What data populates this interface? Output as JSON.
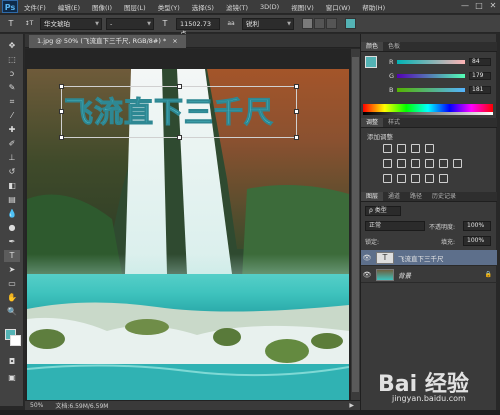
{
  "app": {
    "logo": "Ps"
  },
  "menu": [
    "文件(F)",
    "编辑(E)",
    "图像(I)",
    "图层(L)",
    "类型(Y)",
    "选择(S)",
    "滤镜(T)",
    "3D(D)",
    "视图(V)",
    "窗口(W)",
    "帮助(H)"
  ],
  "window_buttons": [
    "—",
    "□",
    "✕"
  ],
  "options": {
    "tool_icon": "T",
    "orient_icon": "↕T",
    "font_family": "华文琥珀",
    "font_style": "-",
    "font_size_icon": "T",
    "font_size": "11502.73 点",
    "aa_icon": "aa",
    "antialias": "锐利"
  },
  "document": {
    "tab_label": "1.jpg @ 50% (飞流直下三千尺, RGB/8#) *",
    "tab_close": "×",
    "text_content": "飞流直下三千尺"
  },
  "status": {
    "zoom": "50%",
    "doc_info": "文档:6.59M/6.59M"
  },
  "color_panel": {
    "tabs": [
      "颜色",
      "色板"
    ],
    "r_label": "R",
    "g_label": "G",
    "b_label": "B",
    "r": "84",
    "g": "179",
    "b": "181",
    "fg_color": "#54b3b5"
  },
  "adjust_panel": {
    "tabs": [
      "调整",
      "样式"
    ],
    "title": "添加调整"
  },
  "layers_panel": {
    "tabs": [
      "图层",
      "通道",
      "路径",
      "历史记录"
    ],
    "filter_label": "ρ 类型",
    "blend_mode": "正常",
    "opacity_label": "不透明度:",
    "opacity": "100%",
    "lock_label": "锁定:",
    "fill_label": "填充:",
    "fill": "100%",
    "layers": [
      {
        "name": "飞流直下三千尺",
        "kind": "text",
        "thumb": "T"
      },
      {
        "name": "背景",
        "kind": "image",
        "thumb": ""
      }
    ]
  },
  "watermark": {
    "main": "Bai 经验",
    "sub": "jingyan.baidu.com"
  }
}
